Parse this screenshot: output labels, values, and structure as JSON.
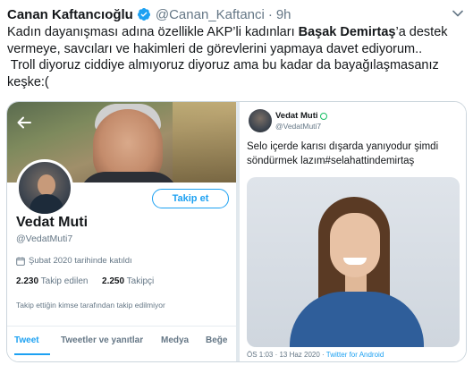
{
  "tweet": {
    "author_name": "Canan Kaftancıoğlu",
    "author_handle": "@Canan_Kaftanci",
    "separator": "·",
    "time": "9h",
    "text_lines": [
      [
        "Kadın dayanışması adına özellikle AKP’li kadınları ",
        "Başak Demirtaş",
        "’a  destek"
      ],
      "vermeye, savcıları ve hakimleri de görevlerini yapmaya davet ediyorum..",
      " Troll diyoruz ciddiye almıyoruz diyoruz ama bu kadar da bayağılaşmasanız",
      "keşke:("
    ]
  },
  "media_left": {
    "follow_button": "Takip et",
    "profile_name": "Vedat Muti",
    "profile_handle": "@VedatMuti7",
    "joined": "Şubat 2020 tarihinde katıldı",
    "following_count": "2.230",
    "following_label": "Takip edilen",
    "followers_count": "2.250",
    "followers_label": "Takipçi",
    "followed_by_note": "Takip ettiğin kimse tarafından takip edilmiyor",
    "tabs": [
      "Tweet",
      "Tweetler ve yanıtlar",
      "Medya",
      "Beğe"
    ]
  },
  "media_right": {
    "name": "Vedat Muti",
    "handle": "@VedatMuti7",
    "text_lines": [
      "Selo içerde karısı dışarda yanıyodur şimdi",
      "söndürmek lazım#selahattindemirtaş"
    ],
    "timestamp": "ÖS 1:03 · 13 Haz 2020 · ",
    "source": "Twitter for Android"
  },
  "icons": {
    "verified": "verified-badge-icon",
    "caret": "chevron-down-icon",
    "back": "back-arrow-icon",
    "calendar": "calendar-icon"
  },
  "colors": {
    "accent": "#1da1f2",
    "text": "#14171a",
    "muted": "#657786"
  }
}
